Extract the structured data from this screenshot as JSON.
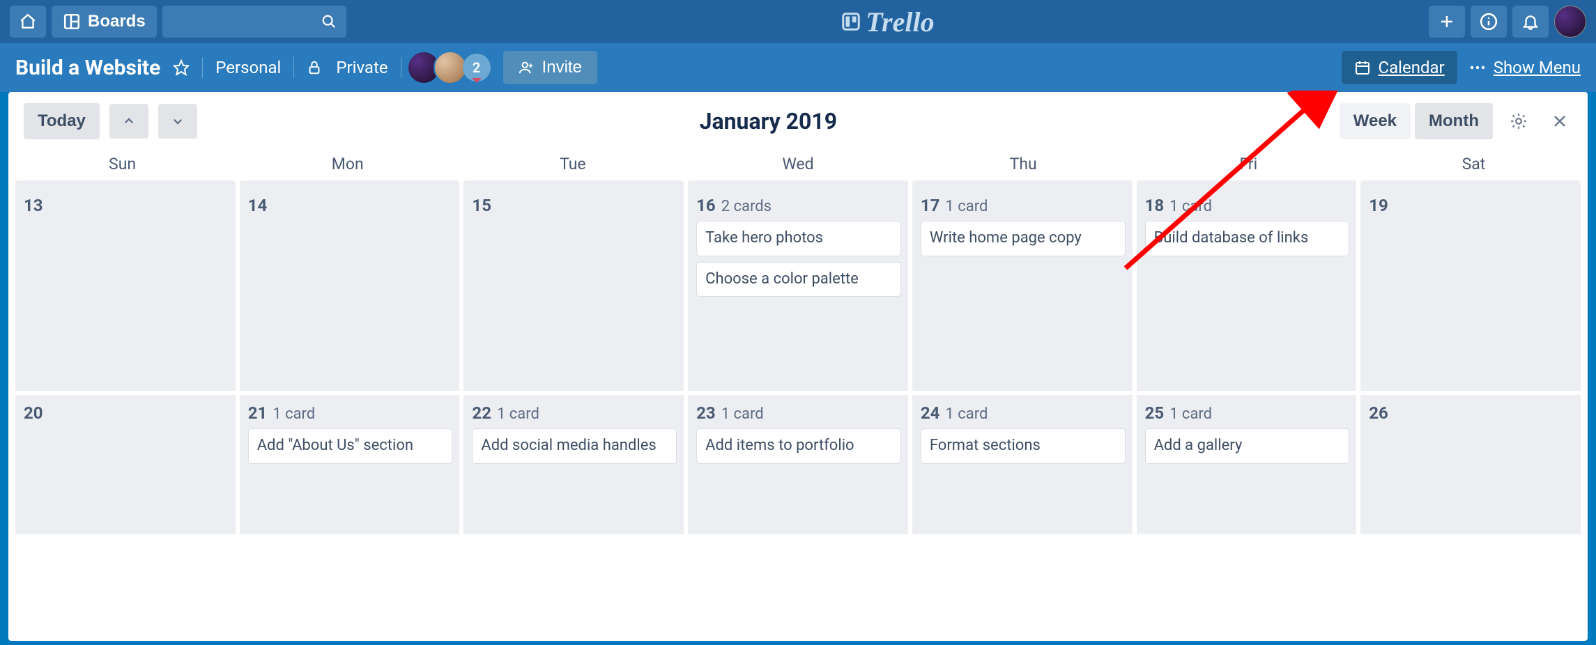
{
  "topbar": {
    "boards_label": "Boards",
    "search_placeholder": ""
  },
  "board_header": {
    "title": "Build a Website",
    "team": "Personal",
    "visibility": "Private",
    "member_count": "2",
    "invite_label": "Invite",
    "calendar_label": "Calendar",
    "show_menu_label": "Show Menu"
  },
  "calendar": {
    "today_label": "Today",
    "title": "January 2019",
    "week_label": "Week",
    "month_label": "Month",
    "weekdays": [
      "Sun",
      "Mon",
      "Tue",
      "Wed",
      "Thu",
      "Fri",
      "Sat"
    ],
    "row1": [
      {
        "date": "13",
        "count": "",
        "cards": []
      },
      {
        "date": "14",
        "count": "",
        "cards": []
      },
      {
        "date": "15",
        "count": "",
        "cards": []
      },
      {
        "date": "16",
        "count": "2 cards",
        "cards": [
          "Take hero photos",
          "Choose a color palette"
        ]
      },
      {
        "date": "17",
        "count": "1 card",
        "cards": [
          "Write home page copy"
        ]
      },
      {
        "date": "18",
        "count": "1 card",
        "cards": [
          "Build database of links"
        ]
      },
      {
        "date": "19",
        "count": "",
        "cards": []
      }
    ],
    "row2": [
      {
        "date": "20",
        "count": "",
        "cards": []
      },
      {
        "date": "21",
        "count": "1 card",
        "cards": [
          "Add \"About Us\" section"
        ]
      },
      {
        "date": "22",
        "count": "1 card",
        "cards": [
          "Add social media handles"
        ]
      },
      {
        "date": "23",
        "count": "1 card",
        "cards": [
          "Add items to portfolio"
        ]
      },
      {
        "date": "24",
        "count": "1 card",
        "cards": [
          "Format sections"
        ]
      },
      {
        "date": "25",
        "count": "1 card",
        "cards": [
          "Add a gallery"
        ]
      },
      {
        "date": "26",
        "count": "",
        "cards": []
      }
    ]
  }
}
